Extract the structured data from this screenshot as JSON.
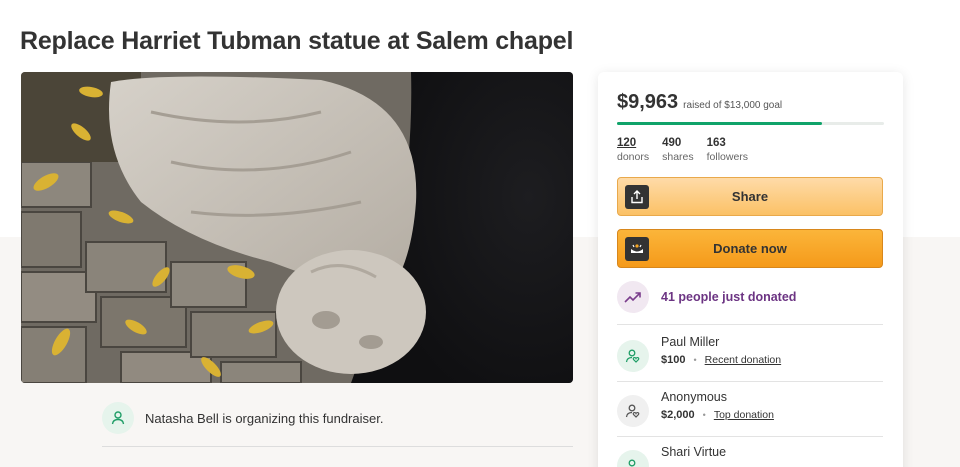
{
  "page": {
    "title": "Replace Harriet Tubman statue at Salem chapel"
  },
  "organizer": {
    "text": "Natasha Bell is organizing this fundraiser.",
    "icon": "user-heart-icon"
  },
  "sidebar": {
    "raised_amount": "$9,963",
    "raised_goal": "raised of $13,000 goal",
    "progress_fraction": 0.766,
    "stats": [
      {
        "value": "120",
        "label": "donors"
      },
      {
        "value": "490",
        "label": "shares"
      },
      {
        "value": "163",
        "label": "followers"
      }
    ],
    "share_label": "Share",
    "donate_label": "Donate now",
    "recent_text": "41 people just donated",
    "donations": [
      {
        "name": "Paul Miller",
        "amount": "$100",
        "tag": "Recent donation"
      },
      {
        "name": "Anonymous",
        "amount": "$2,000",
        "tag": "Top donation"
      },
      {
        "name": "Shari Virtue"
      }
    ]
  },
  "colors": {
    "progress": "#10a36a",
    "share_button": "#fbc166",
    "donate_button": "#f59a1a",
    "recent_text": "#6c3483"
  }
}
